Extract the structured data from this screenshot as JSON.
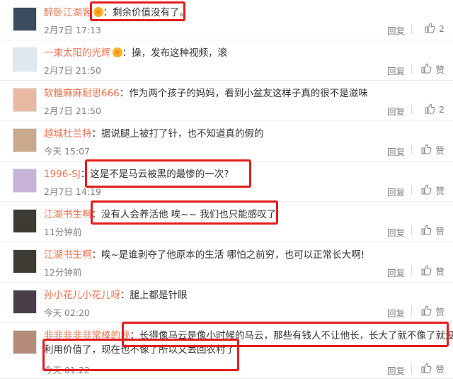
{
  "comments": [
    {
      "user": "醉卧江湖客",
      "vip": true,
      "text": "剩余价值没有了。",
      "time": "2月7日 17:13",
      "reply": "回复",
      "likes": "2",
      "avatar_color": "#3a4c5e"
    },
    {
      "user": "一束太阳的光辉",
      "vip": true,
      "text": "操，发布这种视频，滚",
      "time": "2月7日 21:50",
      "reply": "回复",
      "likes": "赞",
      "avatar_color": "#dfe8ee"
    },
    {
      "user": "软糖麻麻耐思666",
      "vip": false,
      "text": "作为两个孩子的妈妈，看到小盆友这样子真的很不是滋味",
      "time": "2月7日 21:50",
      "reply": "回复",
      "likes": "2",
      "avatar_color": "#e8b9a0"
    },
    {
      "user": "越城杜兰特",
      "vip": false,
      "text": "据说腿上被打了针，也不知道真的假的",
      "time": "今天 15:07",
      "reply": "回复",
      "likes": "赞",
      "avatar_color": "#c9a88c"
    },
    {
      "user": "1996-SJ",
      "vip": false,
      "text": "这是不是马云被黑的最惨的一次?",
      "time": "2月7日 14:19",
      "reply": "回复",
      "likes": "赞",
      "avatar_color": "#c7b3d9"
    },
    {
      "user": "江湖书生啊",
      "vip": false,
      "text": "没有人会养活他 唉~~ 我们也只能感叹了",
      "time": "11分钟前",
      "reply": "回复",
      "likes": "赞",
      "avatar_color": "#3d3b33"
    },
    {
      "user": "江湖书生啊",
      "vip": false,
      "text": "唉~是谁剥夺了他原本的生活 哪怕之前穷，也可以正常长大啊!",
      "time": "12分钟前",
      "reply": "回复",
      "likes": "赞",
      "avatar_color": "#3d3b33"
    },
    {
      "user": "孙小花儿小花儿呀",
      "vip": false,
      "text": "腿上都是针眼",
      "time": "今天 02:20",
      "reply": "回复",
      "likes": "赞",
      "avatar_color": "#4a3f48"
    },
    {
      "user": "非非非非非常棒的我",
      "vip": false,
      "text": "长得像马云是像小时候的马云，那些有钱人不让他长，长大了就不像了就没",
      "text2": "利用价值了，现在也不像了所以又丢回农村了",
      "time": "今天 01:22",
      "reply": "回复",
      "likes": "赞",
      "avatar_color": "#b58c7a"
    }
  ],
  "colors": {
    "username": "#eb7350",
    "highlight": "#e21d1d",
    "text": "#333333",
    "meta": "#808080"
  }
}
